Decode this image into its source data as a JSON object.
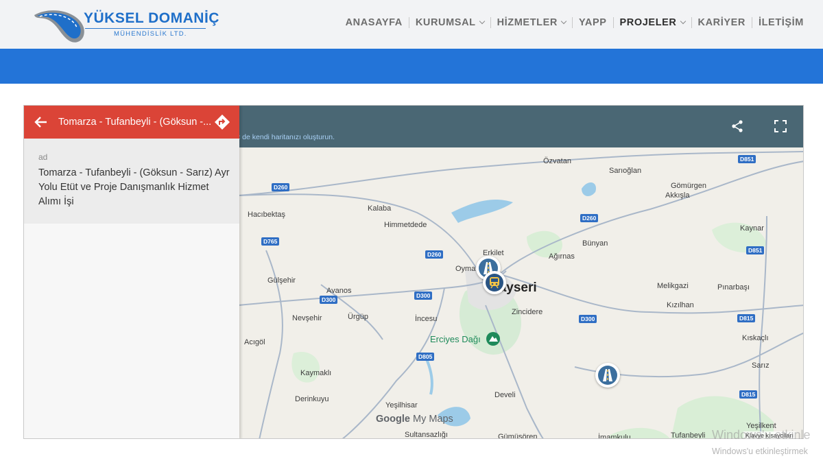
{
  "brand": {
    "title": "YÜKSEL DOMANİÇ",
    "subtitle": "MÜHENDİSLİK LTD.",
    "colors": {
      "primary": "#2374d8",
      "panel_header": "#db4437",
      "map_topbar": "#4a6774"
    }
  },
  "nav": {
    "items": [
      {
        "label": "ANASAYFA",
        "dropdown": false
      },
      {
        "label": "KURUMSAL",
        "dropdown": true
      },
      {
        "label": "HİZMETLER",
        "dropdown": true
      },
      {
        "label": "YAPP",
        "dropdown": false
      },
      {
        "label": "PROJELER",
        "dropdown": true,
        "active": true
      },
      {
        "label": "KARİYER",
        "dropdown": false
      },
      {
        "label": "İLETİŞİM",
        "dropdown": false
      }
    ]
  },
  "map": {
    "topbar_link": "z de kendi haritanızı oluşturun.",
    "share_icon": "share-icon",
    "fullscreen_icon": "fullscreen-icon",
    "panel": {
      "title": "Tomarza - Tufanbeyli - (Göksun -...",
      "label": "ad",
      "text": "Tomarza - Tufanbeyli - (Göksun - Sarız) Ayr Yolu Etüt ve Proje Danışmanlık Hizmet Alımı İşi"
    },
    "attribution": {
      "google": "Google",
      "mymaps": "My Maps"
    },
    "keyboard": "Klavye kısayolları",
    "places": {
      "ozvatan": "Özvatan",
      "sarioglan": "Sarıoğlan",
      "gomurgen": "Gömürgen",
      "akkisla": "Akkışla",
      "kalaba": "Kalaba",
      "hacibektas": "Hacıbektaş",
      "himmetdede": "Himmetdede",
      "kaynar": "Kaynar",
      "bunyan": "Bünyan",
      "erkilet": "Erkilet",
      "oymaagac": "Oyma",
      "agirnas": "Ağırnas",
      "gulsehir": "Gülşehir",
      "avanos": "Avanos",
      "kayseri": "Kayseri",
      "melikgazi": "Melikgazi",
      "pinarbasi": "Pınarbaşı",
      "kizilhan": "Kızılhan",
      "nevsehir": "Nevşehir",
      "urgup": "Ürgüp",
      "incesu": "İncesu",
      "zincidere": "Zincidere",
      "erciyes": "Erciyes Dağı",
      "acigol": "Acıgöl",
      "kiskacli": "Kıskaçlı",
      "sariz": "Sarız",
      "kaymakli": "Kaymaklı",
      "derinkuyu": "Derinkuyu",
      "develi": "Develi",
      "yesilhisar": "Yeşilhisar",
      "sultansazligi": "Sultansazlığı",
      "gumusoren": "Gümüşören",
      "imamkulu": "İmamkulu",
      "tufanbeyli": "Tufanbeyli",
      "yesilkent": "Yeşilkent"
    },
    "roads": {
      "d851a": "D851",
      "d260a": "D260",
      "d260b": "D260",
      "d765": "D765",
      "d260c": "D260",
      "d851b": "D851",
      "d300a": "D300",
      "d300b": "D300",
      "d300c": "D300",
      "d815a": "D815",
      "d805": "D805",
      "d815b": "D815"
    }
  },
  "watermark": {
    "line1": "Windows'u etkinle",
    "line2": "Windows'u etkinleştirmek"
  }
}
